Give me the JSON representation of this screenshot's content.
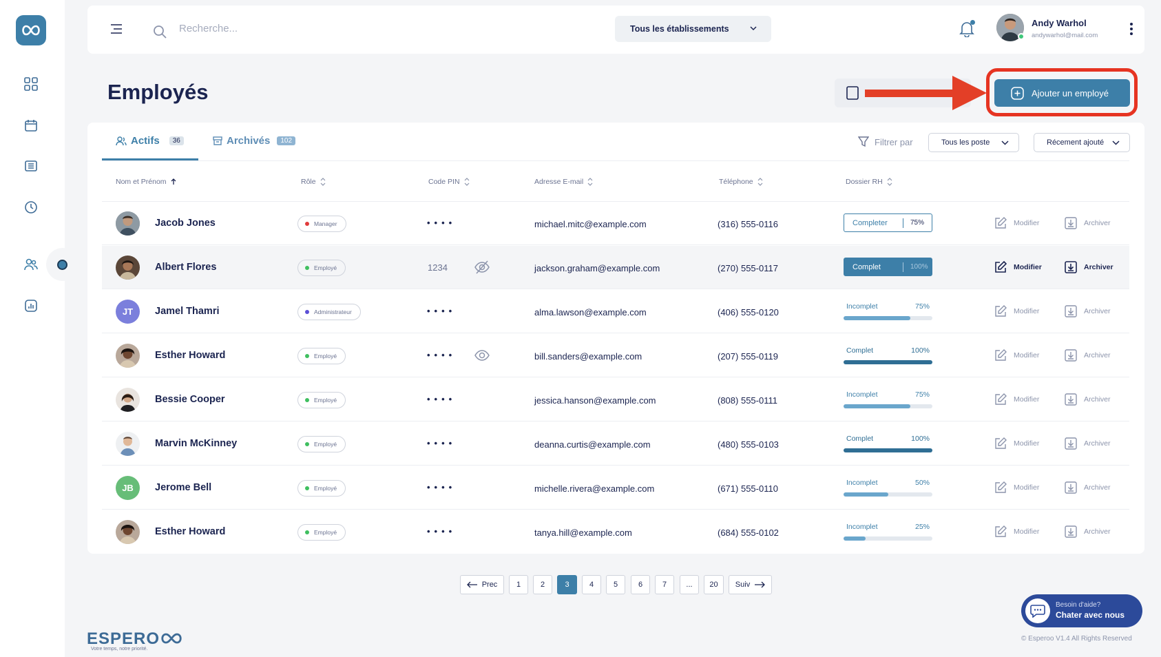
{
  "search": {
    "placeholder": "Recherche..."
  },
  "header": {
    "establishment": "Tous les établissements",
    "user_name": "Andy Warhol",
    "user_email": "andywarhol@mail.com"
  },
  "page": {
    "title": "Employés",
    "add_button": "Ajouter un employé"
  },
  "tabs": [
    {
      "label": "Actifs",
      "count": "36"
    },
    {
      "label": "Archivés",
      "count": "102"
    }
  ],
  "filters": {
    "label": "Filtrer par",
    "poste": "Tous les poste",
    "sort": "Récement ajouté"
  },
  "columns": [
    "Nom et Prénom",
    "Rôle",
    "Code PIN",
    "Adresse E-mail",
    "Téléphone",
    "Dossier RH"
  ],
  "rows": [
    {
      "initials": "",
      "name": "Jacob Jones",
      "role": "Manager",
      "pin": "••••",
      "email": "michael.mitc@example.com",
      "phone": "(316) 555-0116",
      "rh_label": "Completer",
      "rh_pct": "75%"
    },
    {
      "initials": "",
      "name": "Albert Flores",
      "role": "Employé",
      "pin": "1234",
      "email": "jackson.graham@example.com",
      "phone": "(270) 555-0117",
      "rh_label": "Complet",
      "rh_pct": "100%"
    },
    {
      "initials": "JT",
      "name": "Jamel Thamri",
      "role": "Administrateur",
      "pin": "••••",
      "email": "alma.lawson@example.com",
      "phone": "(406) 555-0120",
      "rh_label": "Incomplet",
      "rh_pct": "75%"
    },
    {
      "initials": "",
      "name": "Esther Howard",
      "role": "Employé",
      "pin": "••••",
      "email": "bill.sanders@example.com",
      "phone": "(207) 555-0119",
      "rh_label": "Complet",
      "rh_pct": "100%"
    },
    {
      "initials": "",
      "name": "Bessie Cooper",
      "role": "Employé",
      "pin": "••••",
      "email": "jessica.hanson@example.com",
      "phone": "(808) 555-0111",
      "rh_label": "Incomplet",
      "rh_pct": "75%"
    },
    {
      "initials": "",
      "name": "Marvin McKinney",
      "role": "Employé",
      "pin": "••••",
      "email": "deanna.curtis@example.com",
      "phone": "(480) 555-0103",
      "rh_label": "Complet",
      "rh_pct": "100%"
    },
    {
      "initials": "JB",
      "name": "Jerome Bell",
      "role": "Employé",
      "pin": "••••",
      "email": "michelle.rivera@example.com",
      "phone": "(671) 555-0110",
      "rh_label": "Incomplet",
      "rh_pct": "50%"
    },
    {
      "initials": "",
      "name": "Esther Howard",
      "role": "Employé",
      "pin": "••••",
      "email": "tanya.hill@example.com",
      "phone": "(684) 555-0102",
      "rh_label": "Incomplet",
      "rh_pct": "25%"
    }
  ],
  "actions": {
    "edit": "Modifier",
    "archive": "Archiver"
  },
  "pagination": {
    "prev": "Prec",
    "next": "Suiv",
    "pages": [
      "1",
      "2",
      "3",
      "4",
      "5",
      "6",
      "7",
      "...",
      "20"
    ],
    "current": "3"
  },
  "chat": {
    "line1": "Besoin d'aide?",
    "line2": "Chater avec nous"
  },
  "footer": {
    "brand": "ESPERO",
    "tagline": "Votre temps, notre priorité.",
    "copyright": "© Esperoo V1.4  All Rights Reserved"
  },
  "colors": {
    "accent": "#3d7fa8",
    "highlight": "#e63422",
    "navy": "#1b2450"
  }
}
